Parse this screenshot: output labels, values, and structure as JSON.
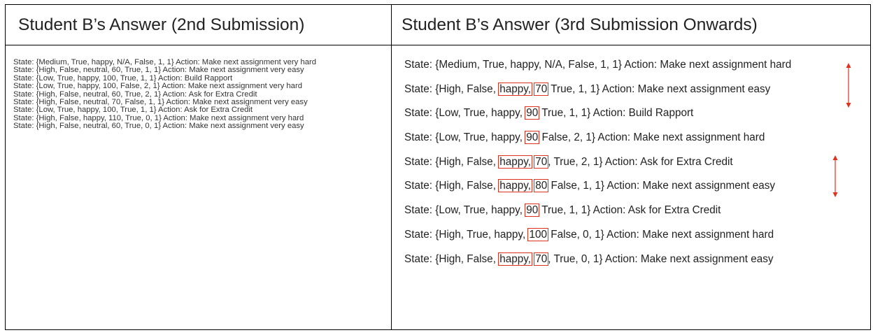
{
  "headers": {
    "left": "Student B’s Answer (2nd Submission)",
    "right": "Student B’s Answer (3rd Submission Onwards)"
  },
  "left_lines": [
    "State: {Medium, True, happy, N/A, False, 1, 1} Action: Make next assignment very hard",
    "State: {High, False, neutral, 60, True, 1, 1} Action: Make next assignment very easy",
    "State: {Low, True, happy, 100, True, 1, 1} Action: Build Rapport",
    "State: {Low, True, happy, 100, False, 2, 1} Action: Make next assignment very hard",
    "State: {High, False, neutral, 60, True, 2, 1} Action: Ask for Extra Credit",
    "State: {High, False, neutral, 70, False, 1, 1} Action: Make next assignment very easy",
    "State: {Low, True, happy, 100, True, 1, 1} Action: Ask for Extra Credit",
    "State: {High, False, happy, 110, True, 0, 1} Action: Make next assignment very hard",
    "State: {High, False, neutral, 60, True, 0, 1} Action: Make next assignment very easy"
  ],
  "right_lines": [
    {
      "prefix": "State: {Medium, True, happy, N/A, False, 1, 1} Action: Make next assignment hard",
      "mood": "",
      "mood_sep": "",
      "score": "",
      "suffix": ""
    },
    {
      "prefix": "State: {High, False, ",
      "mood": "happy,",
      "mood_sep": " ",
      "score": "70",
      "suffix": " True, 1, 1} Action: Make next assignment easy"
    },
    {
      "prefix": "State: {Low, True, happy, ",
      "mood": "",
      "mood_sep": "",
      "score": "90",
      "suffix": " True, 1, 1} Action: Build Rapport"
    },
    {
      "prefix": "State: {Low, True, happy, ",
      "mood": "",
      "mood_sep": "",
      "score": "90",
      "suffix": " False, 2, 1} Action: Make next assignment hard"
    },
    {
      "prefix": "State: {High, False, ",
      "mood": "happy,",
      "mood_sep": " ",
      "score": "70",
      "suffix": ", True, 2, 1} Action: Ask for Extra Credit"
    },
    {
      "prefix": "State: {High, False, ",
      "mood": "happy,",
      "mood_sep": " ",
      "score": "80",
      "suffix": " False, 1, 1} Action: Make next assignment easy"
    },
    {
      "prefix": "State: {Low, True, happy, ",
      "mood": "",
      "mood_sep": "",
      "score": "90",
      "suffix": " True, 1, 1} Action: Ask for Extra Credit"
    },
    {
      "prefix": "State: {High, True, happy, ",
      "mood": "",
      "mood_sep": "",
      "score": "100",
      "suffix": " False, 0, 1} Action: Make next assignment hard"
    },
    {
      "prefix": "State: {High, False, ",
      "mood": "happy,",
      "mood_sep": " ",
      "score": "70",
      "suffix": ", True, 0, 1} Action: Make next assignment easy"
    }
  ],
  "colors": {
    "highlight": "#e0301e",
    "text": "#222222",
    "border": "#000000"
  }
}
